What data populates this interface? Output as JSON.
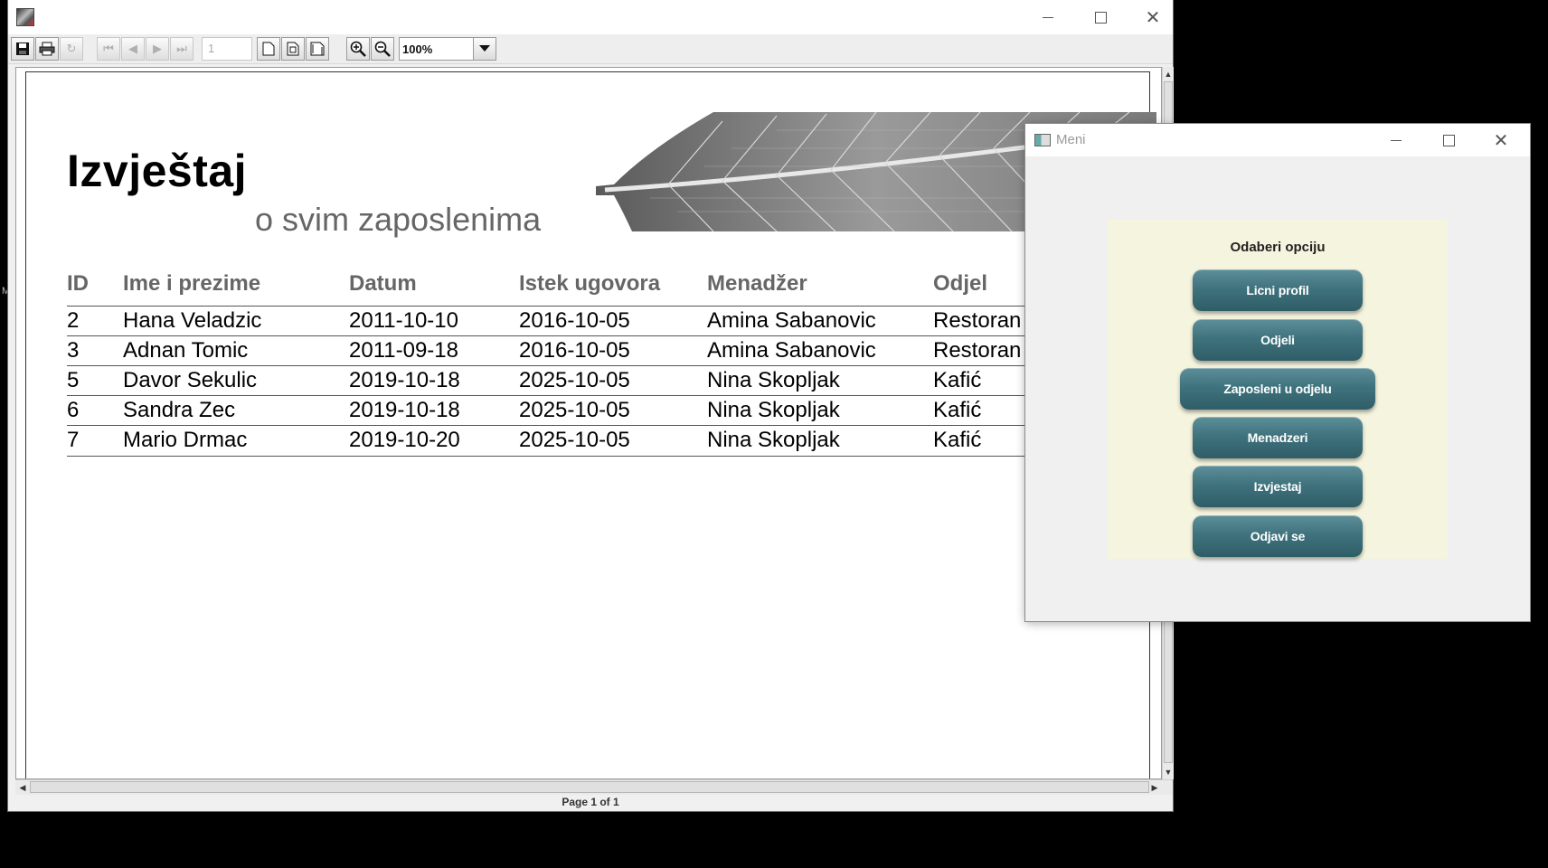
{
  "viewer": {
    "zoom": "100%",
    "page_number": "1",
    "status": "Page 1 of 1"
  },
  "report": {
    "title": "Izvještaj",
    "subtitle": "o svim zaposlenima",
    "columns": [
      "ID",
      "Ime i prezime",
      "Datum",
      "Istek ugovora",
      "Menadžer",
      "Odjel"
    ],
    "rows": [
      [
        "2",
        "Hana Veladzic",
        "2011-10-10",
        "2016-10-05",
        "Amina Sabanovic",
        "Restoran"
      ],
      [
        "3",
        "Adnan Tomic",
        "2011-09-18",
        "2016-10-05",
        "Amina Sabanovic",
        "Restoran"
      ],
      [
        "5",
        "Davor Sekulic",
        "2019-10-18",
        "2025-10-05",
        "Nina Skopljak",
        "Kafić"
      ],
      [
        "6",
        "Sandra Zec",
        "2019-10-18",
        "2025-10-05",
        "Nina Skopljak",
        "Kafić"
      ],
      [
        "7",
        "Mario Drmac",
        "2019-10-20",
        "2025-10-05",
        "Nina Skopljak",
        "Kafić"
      ]
    ]
  },
  "meni": {
    "title": "Meni",
    "heading": "Odaberi opciju",
    "buttons": {
      "licni_profil": "Licni profil",
      "odjeli": "Odjeli",
      "zaposleni_u_odjelu": "Zaposleni u odjelu",
      "menadzeri": "Menadzeri",
      "izvjestaj": "Izvjestaj",
      "odjavi_se": "Odjavi se"
    },
    "colors": {
      "panel": "#f5f5df",
      "button": "#3f737e"
    }
  }
}
